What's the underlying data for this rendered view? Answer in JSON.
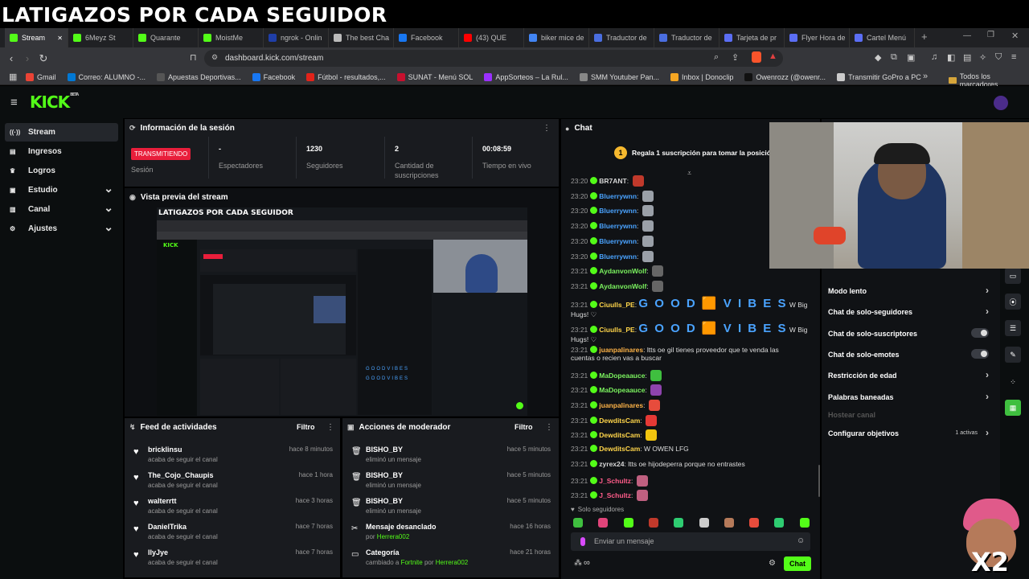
{
  "overlay_title": "LATIGAZOS POR CADA SEGUIDOR",
  "overlay_multiplier": "X2",
  "tabs": [
    {
      "label": "Stream",
      "color": "#53fc18",
      "active": true
    },
    {
      "label": "6Meyz St",
      "color": "#53fc18"
    },
    {
      "label": "Quarante",
      "color": "#53fc18"
    },
    {
      "label": "MoistMe",
      "color": "#53fc18"
    },
    {
      "label": "ngrok - Onlin",
      "color": "#1f3ea8"
    },
    {
      "label": "The best Cha",
      "color": "#bbbbbb"
    },
    {
      "label": "Facebook",
      "color": "#1877f2"
    },
    {
      "label": "(43) QUE",
      "color": "#ff0000"
    },
    {
      "label": "biker mice de",
      "color": "#4285f4"
    },
    {
      "label": "Traductor de",
      "color": "#4a6ee0"
    },
    {
      "label": "Traductor de",
      "color": "#4a6ee0"
    },
    {
      "label": "Tarjeta de pr",
      "color": "#5b6ef5"
    },
    {
      "label": "Flyer Hora de",
      "color": "#5b6ef5"
    },
    {
      "label": "Cartel Menú",
      "color": "#5b6ef5"
    }
  ],
  "address": {
    "url": "dashboard.kick.com/stream"
  },
  "bookmarks": [
    {
      "label": "Gmail",
      "color": "#ea4335"
    },
    {
      "label": "Correo: ALUMNO -...",
      "color": "#0078d4"
    },
    {
      "label": "Apuestas Deportivas...",
      "color": "#555555"
    },
    {
      "label": "Facebook",
      "color": "#1877f2"
    },
    {
      "label": "Fútbol - resultados,...",
      "color": "#e2231a"
    },
    {
      "label": "SUNAT - Menú SOL",
      "color": "#c8102e"
    },
    {
      "label": "AppSorteos – La Rul...",
      "color": "#9b30ff"
    },
    {
      "label": "SMM Youtuber Pan...",
      "color": "#888888"
    },
    {
      "label": "Inbox | Donoclip",
      "color": "#f5a623"
    },
    {
      "label": "Owenrozz (@owenr...",
      "color": "#111111"
    },
    {
      "label": "Transmitir GoPro a PC",
      "color": "#cccccc"
    }
  ],
  "bookmarks_all": "Todos los marcadores",
  "brand": {
    "logo": "KICK",
    "beta": "BETA"
  },
  "sidebar": [
    {
      "label": "Stream",
      "icon": "radio-icon",
      "active": true
    },
    {
      "label": "Ingresos",
      "icon": "wallet-icon"
    },
    {
      "label": "Logros",
      "icon": "trophy-icon"
    },
    {
      "label": "Estudio",
      "icon": "studio-icon",
      "expandable": true
    },
    {
      "label": "Canal",
      "icon": "channel-icon",
      "expandable": true
    },
    {
      "label": "Ajustes",
      "icon": "gear-icon",
      "expandable": true
    }
  ],
  "session": {
    "title": "Información de la sesión",
    "live_badge": "TRANSMITIENDO",
    "session_label": "Sesión",
    "stats": [
      {
        "value": "-",
        "label": "Espectadores"
      },
      {
        "value": "1230",
        "label": "Seguidores"
      },
      {
        "value": "2",
        "label": "Cantidad de suscripciones"
      },
      {
        "value": "00:08:59",
        "label": "Tiempo en vivo"
      }
    ]
  },
  "preview": {
    "title": "Vista previa del stream"
  },
  "activity": {
    "title": "Feed de actividades",
    "filter": "Filtro",
    "items": [
      {
        "user": "bricklinsu",
        "action": "acaba de seguir el canal",
        "time": "hace 8 minutos"
      },
      {
        "user": "The_Cojo_Chaupis",
        "action": "acaba de seguir el canal",
        "time": "hace 1 hora"
      },
      {
        "user": "walterrtt",
        "action": "acaba de seguir el canal",
        "time": "hace 3 horas"
      },
      {
        "user": "DanielTrika",
        "action": "acaba de seguir el canal",
        "time": "hace 7 horas"
      },
      {
        "user": "IlyJye",
        "action": "acaba de seguir el canal",
        "time": "hace 7 horas"
      }
    ]
  },
  "modactions": {
    "title": "Acciones de moderador",
    "filter": "Filtro",
    "items": [
      {
        "title": "BISHO_BY",
        "detail": "eliminó un mensaje",
        "time": "hace 5 minutos",
        "icon": "trash-icon"
      },
      {
        "title": "BISHO_BY",
        "detail": "eliminó un mensaje",
        "time": "hace 5 minutos",
        "icon": "trash-icon"
      },
      {
        "title": "BISHO_BY",
        "detail": "eliminó un mensaje",
        "time": "hace 5 minutos",
        "icon": "trash-icon"
      },
      {
        "title": "Mensaje desanclado",
        "detail_prefix": "por",
        "detail_user": "Herrera002",
        "time": "hace 16 horas",
        "icon": "unpin-icon"
      },
      {
        "title": "Categoría",
        "detail_prefix": "cambiado a",
        "detail_game": "Fortnite",
        "detail_mid": "por",
        "detail_user": "Herrera002",
        "time": "hace 21 horas",
        "icon": "category-icon"
      }
    ]
  },
  "chat": {
    "title": "Chat",
    "gift_banner_num": "1",
    "gift_banner": "Regala 1 suscripción para tomar la posición 1",
    "messages": [
      {
        "time": "23:20",
        "user": "BR7ANT",
        "color": "#d6d6d6",
        "text": "",
        "emote": "#c0392b"
      },
      {
        "time": "23:20",
        "user": "Bluerrywnn",
        "color": "#4aa3ff",
        "text": "",
        "emote": "#9aa0a8"
      },
      {
        "time": "23:20",
        "user": "Bluerrywnn",
        "color": "#4aa3ff",
        "text": "",
        "emote": "#9aa0a8"
      },
      {
        "time": "23:20",
        "user": "Bluerrywnn",
        "color": "#4aa3ff",
        "text": "",
        "emote": "#9aa0a8"
      },
      {
        "time": "23:20",
        "user": "Bluerrywnn",
        "color": "#4aa3ff",
        "text": "",
        "emote": "#9aa0a8"
      },
      {
        "time": "23:20",
        "user": "Bluerrywnn",
        "color": "#4aa3ff",
        "text": "",
        "emote": "#9aa0a8"
      },
      {
        "time": "23:21",
        "user": "AydanvonWolf",
        "color": "#7bf25f",
        "text": "",
        "emote": "#666666"
      },
      {
        "time": "23:21",
        "user": "AydanvonWolf",
        "color": "#7bf25f",
        "text": "",
        "emote": "#666666"
      },
      {
        "time": "23:21",
        "user": "Ciuulls_PE",
        "color": "#ffd54a",
        "big": "G O O D 🟧 V I B E S",
        "tail": "W Big",
        "tail2": "Hugs! ♡"
      },
      {
        "time": "23:21",
        "user": "Ciuulls_PE",
        "color": "#ffd54a",
        "big": "G O O D 🟧 V I B E S",
        "tail": "W Big",
        "tail2": "Hugs! ♡"
      },
      {
        "time": "23:21",
        "user": "juanpalinares",
        "color": "#ffb347",
        "text": "ltts oe gil tienes proveedor que te venda las",
        "text2": "cuentas o recien vas a buscar"
      },
      {
        "time": "23:21",
        "user": "MaDopeaauce",
        "color": "#7bf25f",
        "text": "",
        "emote": "#3fbf3f"
      },
      {
        "time": "23:21",
        "user": "MaDopeaauce",
        "color": "#7bf25f",
        "text": "",
        "emote": "#8e44ad"
      },
      {
        "time": "23:21",
        "user": "juanpalinares",
        "color": "#ffb347",
        "text": "",
        "emote": "#e74c3c"
      },
      {
        "time": "23:21",
        "user": "DewditsCam",
        "color": "#ffd54a",
        "text": "",
        "emote": "#e53935"
      },
      {
        "time": "23:21",
        "user": "DewditsCam",
        "color": "#ffd54a",
        "text": "",
        "emote": "#f1c40f"
      },
      {
        "time": "23:21",
        "user": "DewditsCam",
        "color": "#ffd54a",
        "text": "W OWEN LFG"
      },
      {
        "time": "23:21",
        "user": "zyrex24",
        "color": "#d6d6d6",
        "text": "ltts oe hijodeperra porque no entrastes"
      },
      {
        "time": "23:21",
        "user": "J_Schultz",
        "color": "#ff5c8a",
        "text": "",
        "emote": "#c06080"
      },
      {
        "time": "23:21",
        "user": "J_Schultz",
        "color": "#ff5c8a",
        "text": "",
        "emote": "#c06080"
      }
    ],
    "followers_only": "Solo seguidores",
    "input_placeholder": "Enviar un mensaje",
    "send_label": "Chat"
  },
  "chat_settings": [
    {
      "label": "Modo lento",
      "kind": "arrow"
    },
    {
      "label": "Chat de solo-seguidores",
      "kind": "arrow"
    },
    {
      "label": "Chat de solo-suscriptores",
      "kind": "toggle"
    },
    {
      "label": "Chat de solo-emotes",
      "kind": "toggle"
    },
    {
      "label": "Restricción de edad",
      "kind": "arrow"
    },
    {
      "label": "Palabras baneadas",
      "kind": "arrow"
    },
    {
      "label": "Hostear canal",
      "kind": "disabled"
    },
    {
      "label": "Configurar objetivos",
      "kind": "arrow",
      "badge": "1 activas"
    }
  ]
}
